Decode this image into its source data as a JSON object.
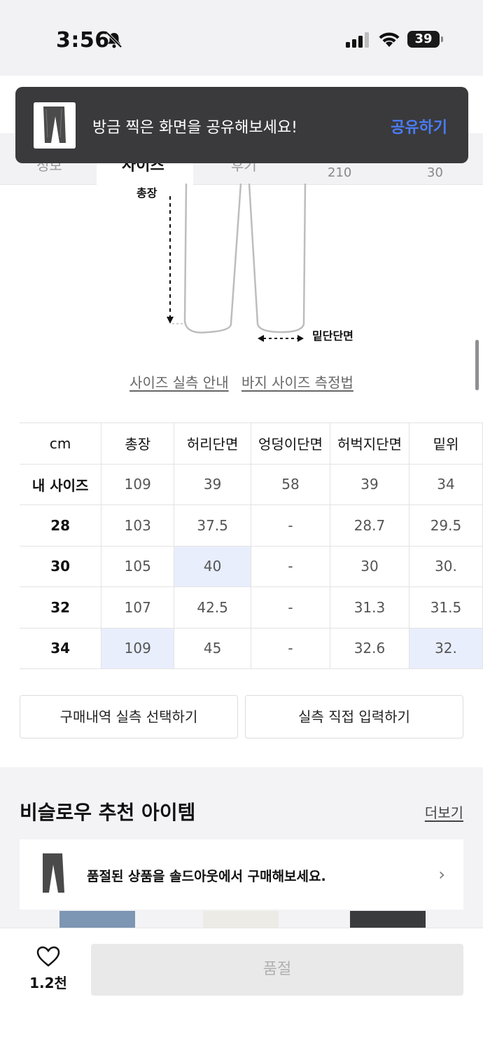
{
  "status_bar": {
    "time": "3:56",
    "battery": "39"
  },
  "tabs": {
    "items": [
      "정보",
      "사이즈",
      "후기"
    ],
    "active": "사이즈",
    "numbers": [
      "210",
      "30"
    ]
  },
  "toast": {
    "message": "방금 찍은 화면을 공유해보세요!",
    "action": "공유하기"
  },
  "diagram": {
    "label_total": "총장",
    "label_hem": "밑단단면"
  },
  "guide_links": [
    "사이즈 실측 안내",
    "바지 사이즈 측정법"
  ],
  "size_table": {
    "headers": [
      "cm",
      "총장",
      "허리단면",
      "엉덩이단면",
      "허벅지단면",
      "밑위"
    ],
    "rows": [
      [
        "내 사이즈",
        "109",
        "39",
        "58",
        "39",
        "34"
      ],
      [
        "28",
        "103",
        "37.5",
        "-",
        "28.7",
        "29.5"
      ],
      [
        "30",
        "105",
        "40",
        "-",
        "30",
        "30."
      ],
      [
        "32",
        "107",
        "42.5",
        "-",
        "31.3",
        "31.5"
      ],
      [
        "34",
        "109",
        "45",
        "-",
        "32.6",
        "32."
      ]
    ]
  },
  "buttons": {
    "purchase_history": "구매내역 실측 선택하기",
    "manual_input": "실측 직접 입력하기"
  },
  "recommend": {
    "title": "비슬로우 추천 아이템",
    "more": "더보기",
    "soldout_text": "품절된 상품을 솔드아웃에서 구매해보세요."
  },
  "bottom": {
    "likes": "1.2천",
    "buy_label": "품절"
  },
  "colors": {
    "accent": "#4a7cf6",
    "highlight": "#e8eefc",
    "toast_bg": "#3a3a3c"
  }
}
